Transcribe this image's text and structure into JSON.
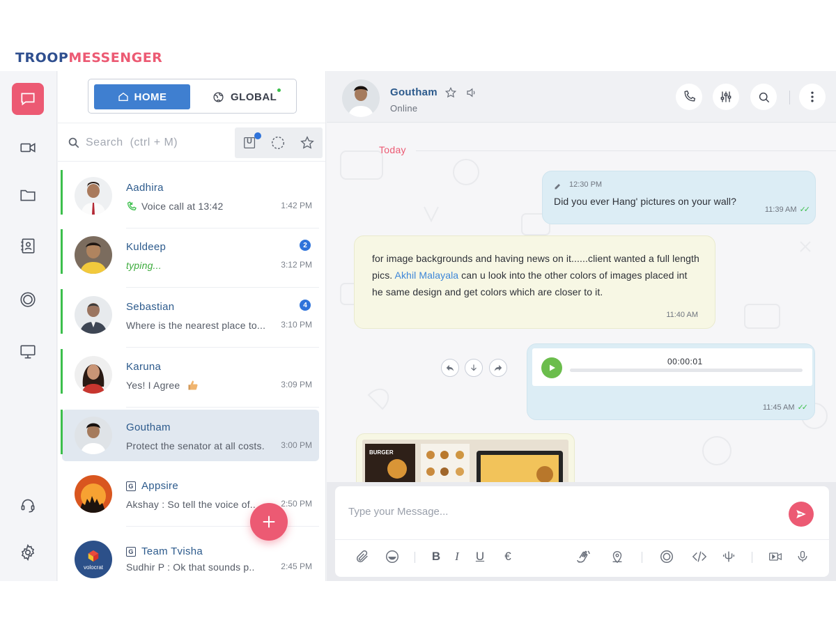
{
  "brand": {
    "part1": "TROOP",
    "part2": "MESSENGER"
  },
  "switcher": {
    "home_label": "HOME",
    "global_label": "GLOBAL"
  },
  "search": {
    "placeholder": "Search  (ctrl + M)"
  },
  "filters": {
    "unread_label": "U"
  },
  "conversations": [
    {
      "name": "Aadhira",
      "preview": "Voice call at 13:42",
      "time": "1:42 PM",
      "badge": ""
    },
    {
      "name": "Kuldeep",
      "preview": "typing...",
      "time": "3:12 PM",
      "badge": "2"
    },
    {
      "name": "Sebastian",
      "preview": "Where is the nearest place to...",
      "time": "3:10 PM",
      "badge": "4"
    },
    {
      "name": "Karuna",
      "preview": "Yes! I Agree",
      "time": "3:09 PM",
      "badge": ""
    },
    {
      "name": "Goutham",
      "preview": "Protect the senator at all costs.",
      "time": "3:00 PM",
      "badge": ""
    },
    {
      "name": "Appsire",
      "group_icon": "G",
      "preview": "Akshay  : So tell the voice of..",
      "time": "2:50 PM",
      "badge": ""
    },
    {
      "name": "Team Tvisha",
      "group_icon": "G",
      "preview": "Sudhir P : Ok that sounds p..",
      "time": "2:45 PM",
      "badge": "",
      "avatar_text": "volocrat"
    }
  ],
  "chat": {
    "contact_name": "Goutham",
    "status": "Online",
    "day_label": "Today",
    "messages": {
      "m1": {
        "edited_time": "12:30 PM",
        "text": "Did you ever Hang' pictures on your wall?",
        "time": "11:39 AM"
      },
      "m2": {
        "text_before": "for image backgrounds and having news on it......client wanted a full length pics. ",
        "mention": "Akhil Malayala",
        "text_after": " can u look into the other colors of images placed int he same design and get colors which are closer to it.",
        "time": "11:40 AM"
      },
      "m3": {
        "audio_duration": "00:00:01",
        "time": "11:45 AM"
      },
      "m4": {
        "image_caption": "BURGER"
      }
    }
  },
  "composer": {
    "placeholder": "Type your Message...",
    "bold": "B",
    "italic": "I",
    "underline": "U",
    "strike": "€"
  },
  "colors": {
    "accent": "#ec5a73",
    "primary": "#3f7fd0",
    "online": "#3cbf4c",
    "outgoing": "#dcedf5",
    "incoming": "#f7f7e4"
  }
}
